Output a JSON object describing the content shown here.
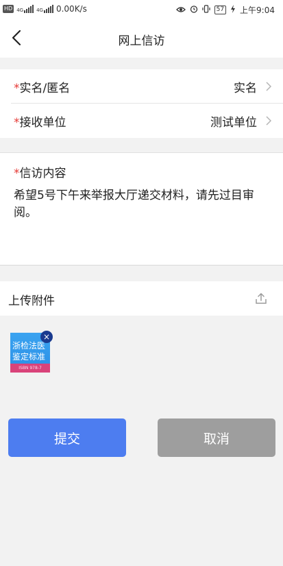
{
  "status_bar": {
    "hd_badge": "HD",
    "signal1_tag": "4G",
    "signal2_tag": "4G",
    "speed": "0.00K/s",
    "battery": "57",
    "time": "上午9:04"
  },
  "header": {
    "title": "网上信访"
  },
  "form": {
    "realname": {
      "required": "*",
      "label": "实名/匿名",
      "value": "实名"
    },
    "receiver": {
      "required": "*",
      "label": "接收单位",
      "value": "测试单位"
    },
    "content": {
      "required": "*",
      "label": "信访内容",
      "text": "希望5号下午来举报大厅递交材料，请先过目审阅。"
    }
  },
  "attachments": {
    "label": "上传附件",
    "thumbnail": {
      "line1": "浙检法医",
      "line2": "鉴定标准",
      "footer": "ISBN 978-7"
    }
  },
  "actions": {
    "submit": "提交",
    "cancel": "取消"
  },
  "colors": {
    "submit_bg": "#4d7df0",
    "cancel_bg": "#9e9e9e",
    "required": "#e53935"
  }
}
